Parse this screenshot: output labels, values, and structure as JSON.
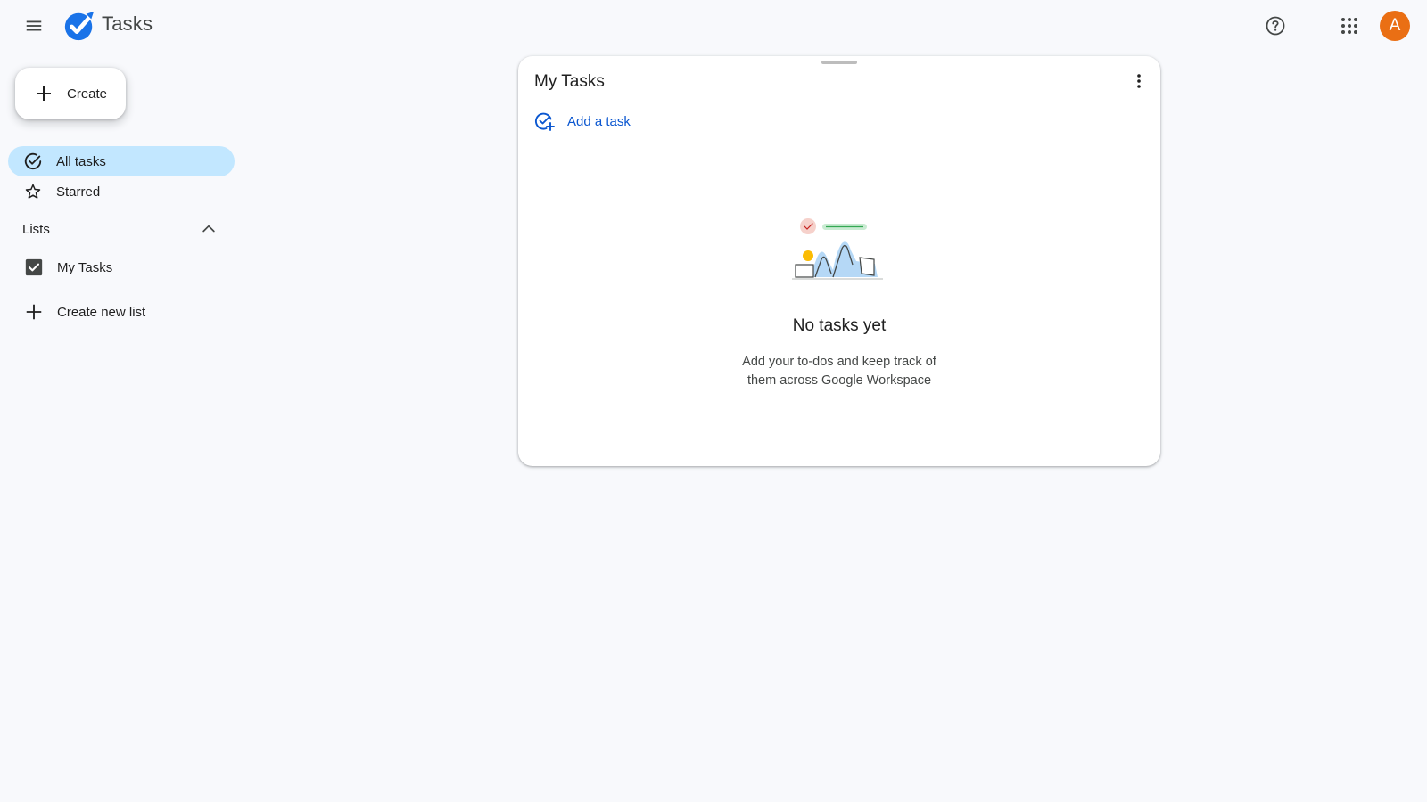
{
  "header": {
    "app_title": "Tasks",
    "menu_icon": "hamburger-menu-icon",
    "logo_icon": "tasks-logo-icon",
    "help_icon": "help-circle-icon",
    "apps_icon": "apps-grid-icon",
    "avatar_letter": "A",
    "avatar_color": "#ea6f14"
  },
  "sidebar": {
    "create_label": "Create",
    "nav": [
      {
        "label": "All tasks",
        "icon": "check-circle-icon",
        "active": true
      },
      {
        "label": "Starred",
        "icon": "star-outline-icon",
        "active": false
      }
    ],
    "lists_label": "Lists",
    "lists": [
      {
        "label": "My Tasks",
        "checked": true
      }
    ],
    "create_list_label": "Create new list"
  },
  "main": {
    "title": "My Tasks",
    "add_task_label": "Add a task",
    "empty_title": "No tasks yet",
    "empty_desc_line1": "Add your to-dos and keep track of",
    "empty_desc_line2": "them across Google Workspace"
  },
  "colors": {
    "accent_blue": "#0b57d0",
    "active_nav_bg": "#c2e7ff",
    "background": "#f8f9fc"
  }
}
